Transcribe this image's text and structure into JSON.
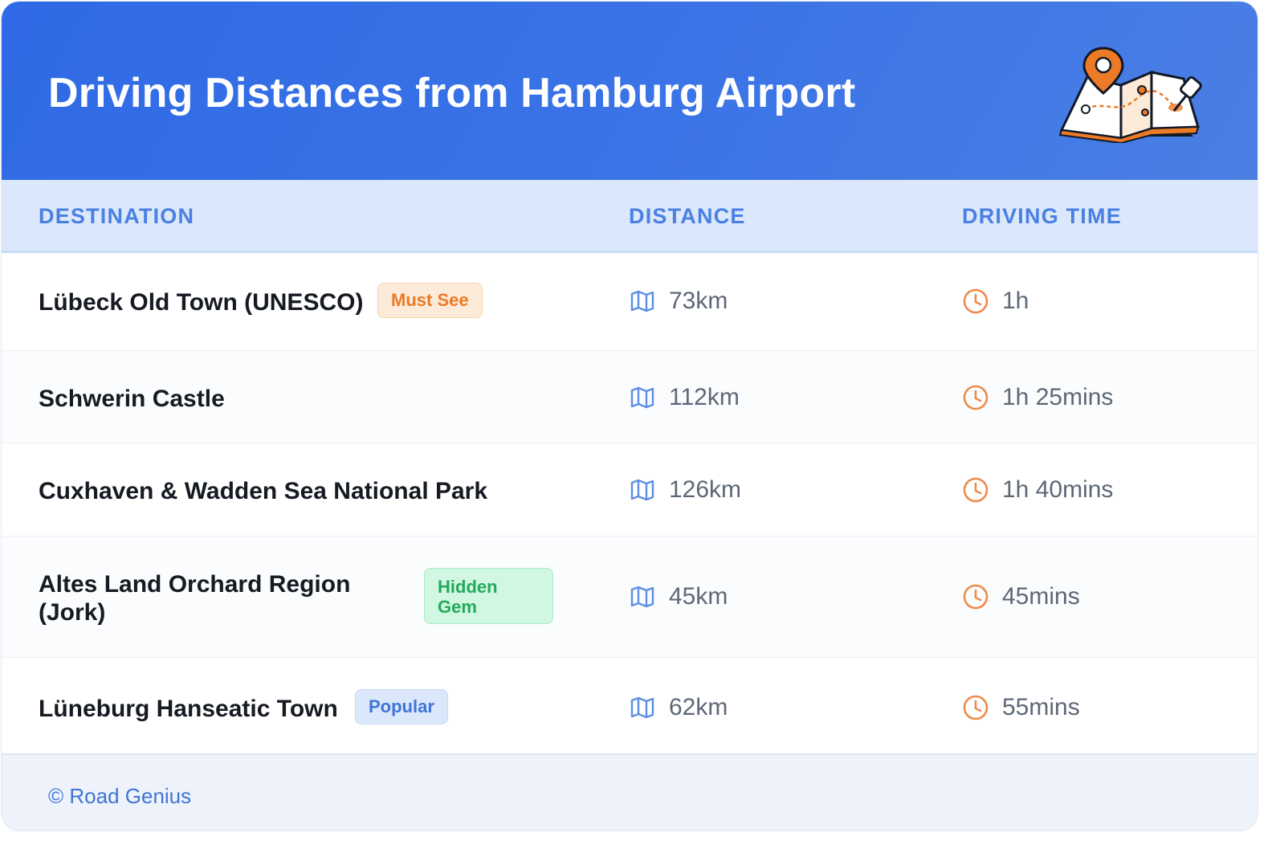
{
  "header": {
    "title": "Driving Distances from Hamburg Airport",
    "illustration_icon": "map-with-pins"
  },
  "table": {
    "columns": [
      "DESTINATION",
      "DISTANCE",
      "DRIVING TIME"
    ],
    "rows": [
      {
        "destination": "Lübeck Old Town (UNESCO)",
        "badge": "Must See",
        "badge_color": "orange",
        "distance": "73km",
        "time": "1h"
      },
      {
        "destination": "Schwerin Castle",
        "badge": "",
        "badge_color": "",
        "distance": "112km",
        "time": "1h 25mins"
      },
      {
        "destination": "Cuxhaven & Wadden Sea National Park",
        "badge": "",
        "badge_color": "",
        "distance": "126km",
        "time": "1h 40mins"
      },
      {
        "destination": "Altes Land Orchard Region (Jork)",
        "badge": "Hidden Gem",
        "badge_color": "green",
        "distance": "45km",
        "time": "45mins"
      },
      {
        "destination": "Lüneburg Hanseatic Town",
        "badge": "Popular",
        "badge_color": "blue",
        "distance": "62km",
        "time": "55mins"
      }
    ],
    "distance_icon": "map-icon",
    "time_icon": "clock-icon"
  },
  "footer": {
    "text": "© Road Genius"
  },
  "colors": {
    "header": "#2f6ae6",
    "accent": "#4a7fe4",
    "orange": "#ec7a26",
    "green": "#23aa5a"
  }
}
